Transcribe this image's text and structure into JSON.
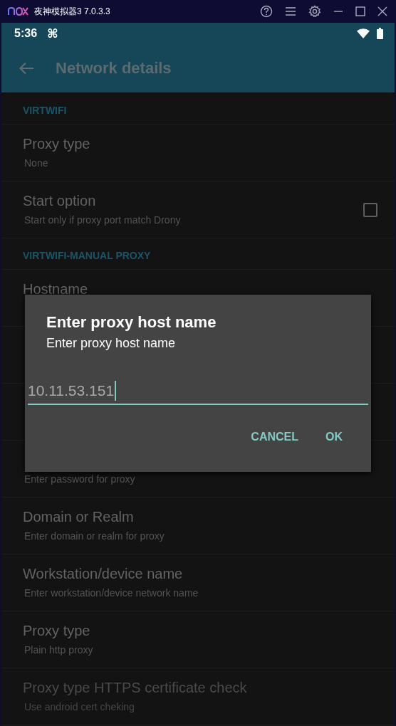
{
  "window": {
    "title": "夜神模拟器3 7.0.3.3"
  },
  "status_bar": {
    "time": "5:36",
    "glyph": "⌘"
  },
  "app_bar": {
    "title": "Network details"
  },
  "sections": [
    {
      "header": "VIRTWIFI",
      "rows": [
        {
          "kind": "text",
          "title": "Proxy type",
          "subtitle": "None",
          "disabled": false
        },
        {
          "kind": "checkbox",
          "title": "Start option",
          "subtitle": "Start only if proxy port match Drony",
          "checked": false,
          "disabled": false
        }
      ]
    },
    {
      "header": "VIRTWIFI-MANUAL PROXY",
      "rows": [
        {
          "kind": "text",
          "title": "Hostname",
          "disabled": false
        },
        {
          "kind": "covered"
        },
        {
          "kind": "covered"
        },
        {
          "kind": "text",
          "subtitle": "Enter password for proxy",
          "disabled": false
        },
        {
          "kind": "text",
          "title": "Domain or Realm",
          "subtitle": "Enter domain or realm for proxy",
          "disabled": false
        },
        {
          "kind": "text",
          "title": "Workstation/device name",
          "subtitle": "Enter workstation/device network name",
          "disabled": false
        },
        {
          "kind": "text",
          "title": "Proxy type",
          "subtitle": "Plain http proxy",
          "disabled": false
        },
        {
          "kind": "text",
          "title": "Proxy type HTTPS certificate check",
          "subtitle": "Use android cert cheking",
          "disabled": true
        }
      ]
    }
  ],
  "dialog": {
    "title": "Enter proxy host name",
    "message": "Enter proxy host name",
    "value": "10.11.53.151",
    "buttons": [
      "CANCEL",
      "OK"
    ]
  }
}
